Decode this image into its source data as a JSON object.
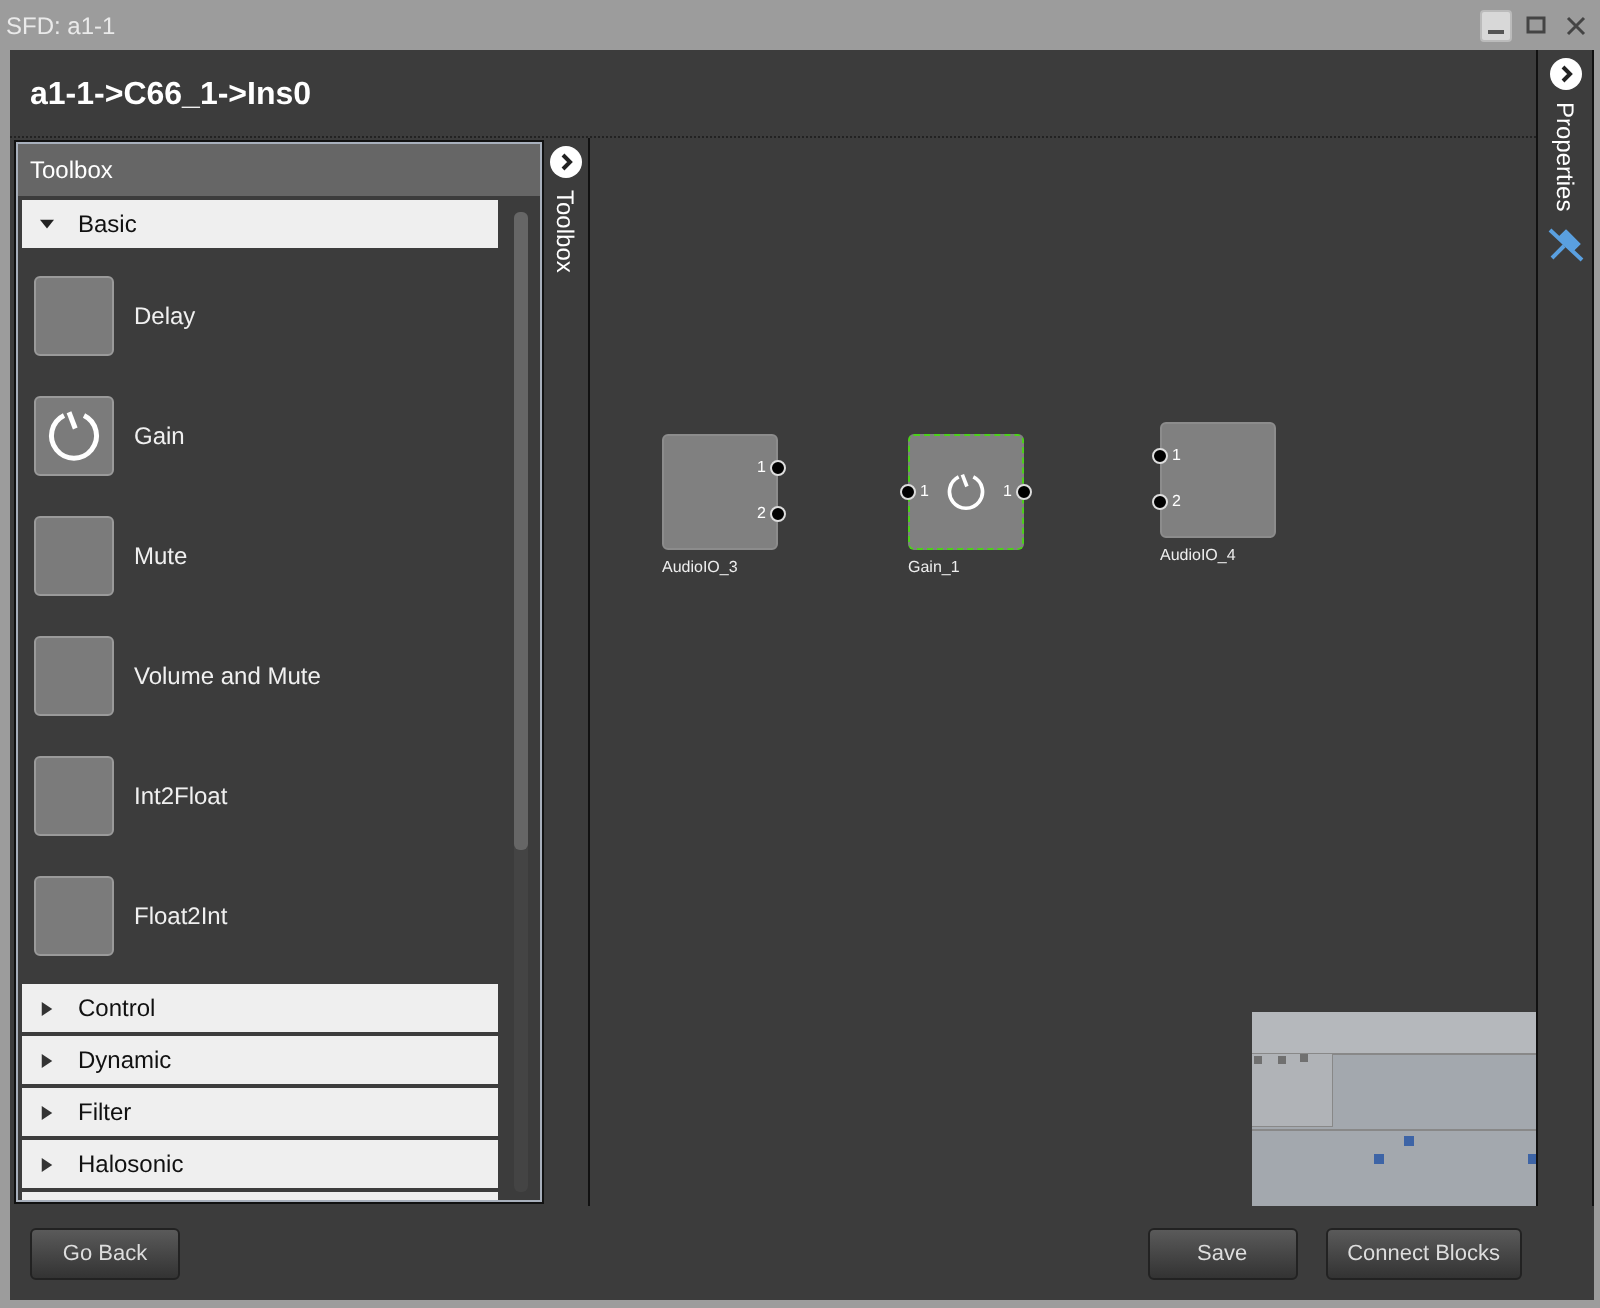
{
  "window": {
    "title": "SFD: a1-1"
  },
  "breadcrumb": "a1-1->C66_1->Ins0",
  "toolbox": {
    "title": "Toolbox",
    "tab_label": "Toolbox",
    "categories": [
      {
        "label": "Basic",
        "expanded": true,
        "items": [
          {
            "label": "Delay",
            "kind": "plain"
          },
          {
            "label": "Gain",
            "kind": "knob"
          },
          {
            "label": "Mute",
            "kind": "plain"
          },
          {
            "label": "Volume and Mute",
            "kind": "plain"
          },
          {
            "label": "Int2Float",
            "kind": "plain"
          },
          {
            "label": "Float2Int",
            "kind": "plain"
          }
        ]
      },
      {
        "label": "Control",
        "expanded": false
      },
      {
        "label": "Dynamic",
        "expanded": false
      },
      {
        "label": "Filter",
        "expanded": false
      },
      {
        "label": "Halosonic",
        "expanded": false
      }
    ]
  },
  "properties_tab": {
    "label": "Properties"
  },
  "canvas": {
    "blocks": [
      {
        "name": "AudioIO_3",
        "kind": "plain",
        "selected": false,
        "outputs": [
          "1",
          "2"
        ]
      },
      {
        "name": "Gain_1",
        "kind": "knob",
        "selected": true,
        "inputs": [
          "1"
        ],
        "outputs": [
          "1"
        ]
      },
      {
        "name": "AudioIO_4",
        "kind": "plain",
        "selected": false,
        "inputs": [
          "1",
          "2"
        ]
      }
    ]
  },
  "buttons": {
    "left": [
      "Go Back"
    ],
    "right": [
      "Save",
      "Connect Blocks"
    ]
  }
}
